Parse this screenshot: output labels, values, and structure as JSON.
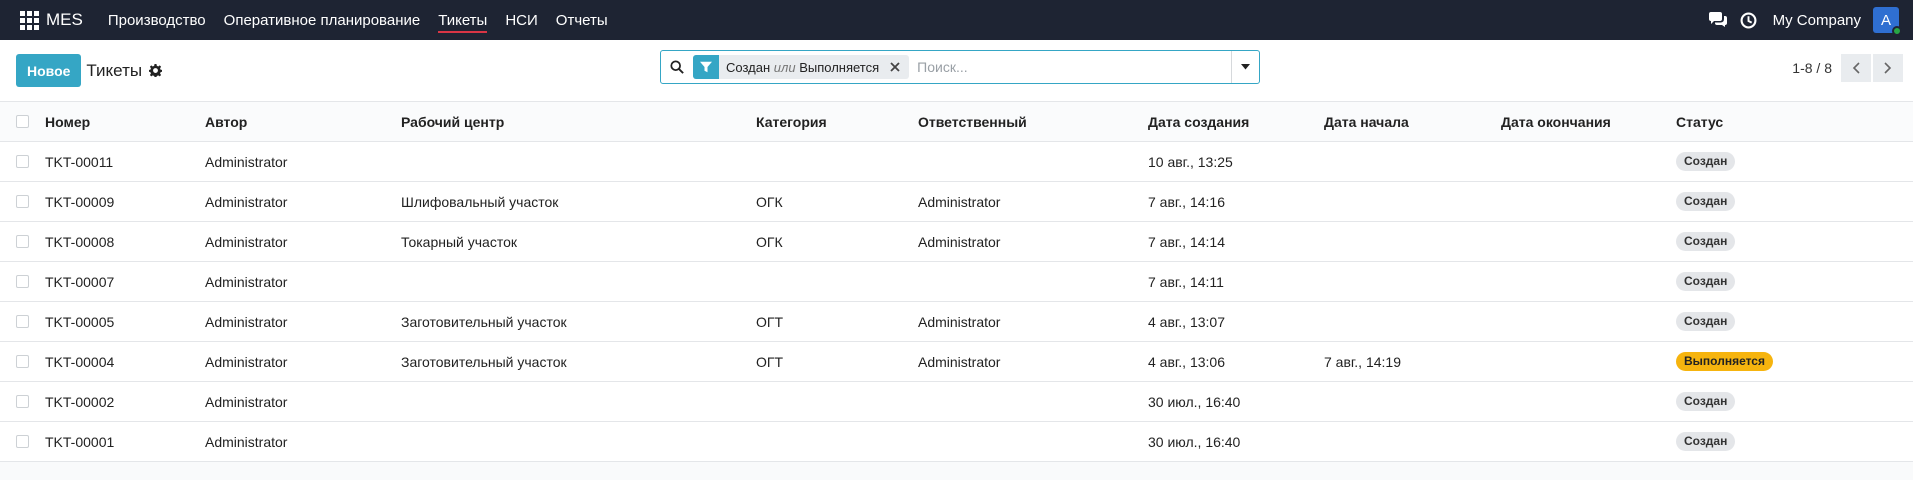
{
  "navbar": {
    "brand": "MES",
    "menu": [
      {
        "label": "Производство",
        "active": false
      },
      {
        "label": "Оперативное планирование",
        "active": false
      },
      {
        "label": "Тикеты",
        "active": true
      },
      {
        "label": "НСИ",
        "active": false
      },
      {
        "label": "Отчеты",
        "active": false
      }
    ],
    "company": "My Company",
    "avatar_letter": "A"
  },
  "control": {
    "new_button": "Новое",
    "breadcrumb": "Тикеты",
    "search": {
      "facet_value1": "Создан",
      "facet_or": "или",
      "facet_value2": "Выполняется",
      "placeholder": "Поиск..."
    },
    "pager": "1-8 / 8"
  },
  "table": {
    "columns": [
      "Номер",
      "Автор",
      "Рабочий центр",
      "Категория",
      "Ответственный",
      "Дата создания",
      "Дата начала",
      "Дата окончания",
      "Статус"
    ],
    "rows": [
      {
        "number": "TKT-00011",
        "author": "Administrator",
        "center": "",
        "category": "",
        "responsible": "",
        "created": "10 авг., 13:25",
        "start": "",
        "end": "",
        "status": "Создан",
        "status_kind": "created"
      },
      {
        "number": "TKT-00009",
        "author": "Administrator",
        "center": "Шлифовальный участок",
        "category": "ОГК",
        "responsible": "Administrator",
        "created": "7 авг., 14:16",
        "start": "",
        "end": "",
        "status": "Создан",
        "status_kind": "created"
      },
      {
        "number": "TKT-00008",
        "author": "Administrator",
        "center": "Токарный участок",
        "category": "ОГК",
        "responsible": "Administrator",
        "created": "7 авг., 14:14",
        "start": "",
        "end": "",
        "status": "Создан",
        "status_kind": "created"
      },
      {
        "number": "TKT-00007",
        "author": "Administrator",
        "center": "",
        "category": "",
        "responsible": "",
        "created": "7 авг., 14:11",
        "start": "",
        "end": "",
        "status": "Создан",
        "status_kind": "created"
      },
      {
        "number": "TKT-00005",
        "author": "Administrator",
        "center": "Заготовительный участок",
        "category": "ОГТ",
        "responsible": "Administrator",
        "created": "4 авг., 13:07",
        "start": "",
        "end": "",
        "status": "Создан",
        "status_kind": "created"
      },
      {
        "number": "TKT-00004",
        "author": "Administrator",
        "center": "Заготовительный участок",
        "category": "ОГТ",
        "responsible": "Administrator",
        "created": "4 авг., 13:06",
        "start": "7 авг., 14:19",
        "end": "",
        "status": "Выполняется",
        "status_kind": "working"
      },
      {
        "number": "TKT-00002",
        "author": "Administrator",
        "center": "",
        "category": "",
        "responsible": "",
        "created": "30 июл., 16:40",
        "start": "",
        "end": "",
        "status": "Создан",
        "status_kind": "created"
      },
      {
        "number": "TKT-00001",
        "author": "Administrator",
        "center": "",
        "category": "",
        "responsible": "",
        "created": "30 июл., 16:40",
        "start": "",
        "end": "",
        "status": "Создан",
        "status_kind": "created"
      }
    ]
  },
  "colors": {
    "navbar": "#1e2433",
    "accent": "#35a6c5",
    "active_underline": "#d93545",
    "badge_working": "#f6b40e"
  }
}
